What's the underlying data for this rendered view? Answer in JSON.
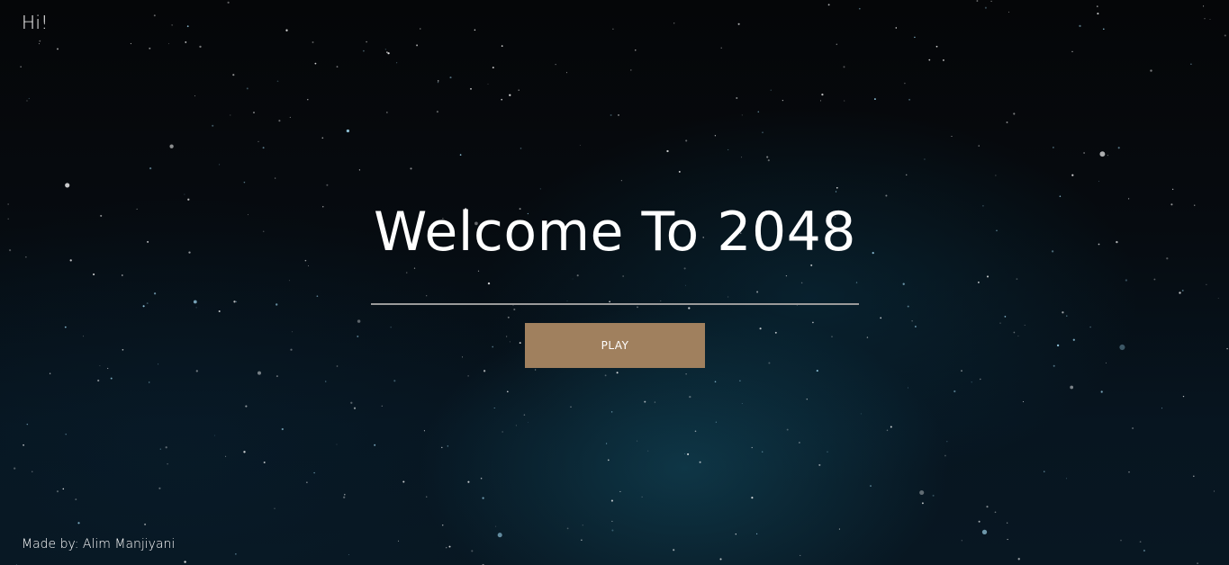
{
  "header": {
    "greeting": "Hi!"
  },
  "hero": {
    "title": "Welcome To 2048",
    "play_label": "PLAY"
  },
  "footer": {
    "credit": "Made by: Alim Manjiyani"
  },
  "colors": {
    "play_button": "#a0805e",
    "divider": "#9a9a9a",
    "text": "#ffffff"
  }
}
